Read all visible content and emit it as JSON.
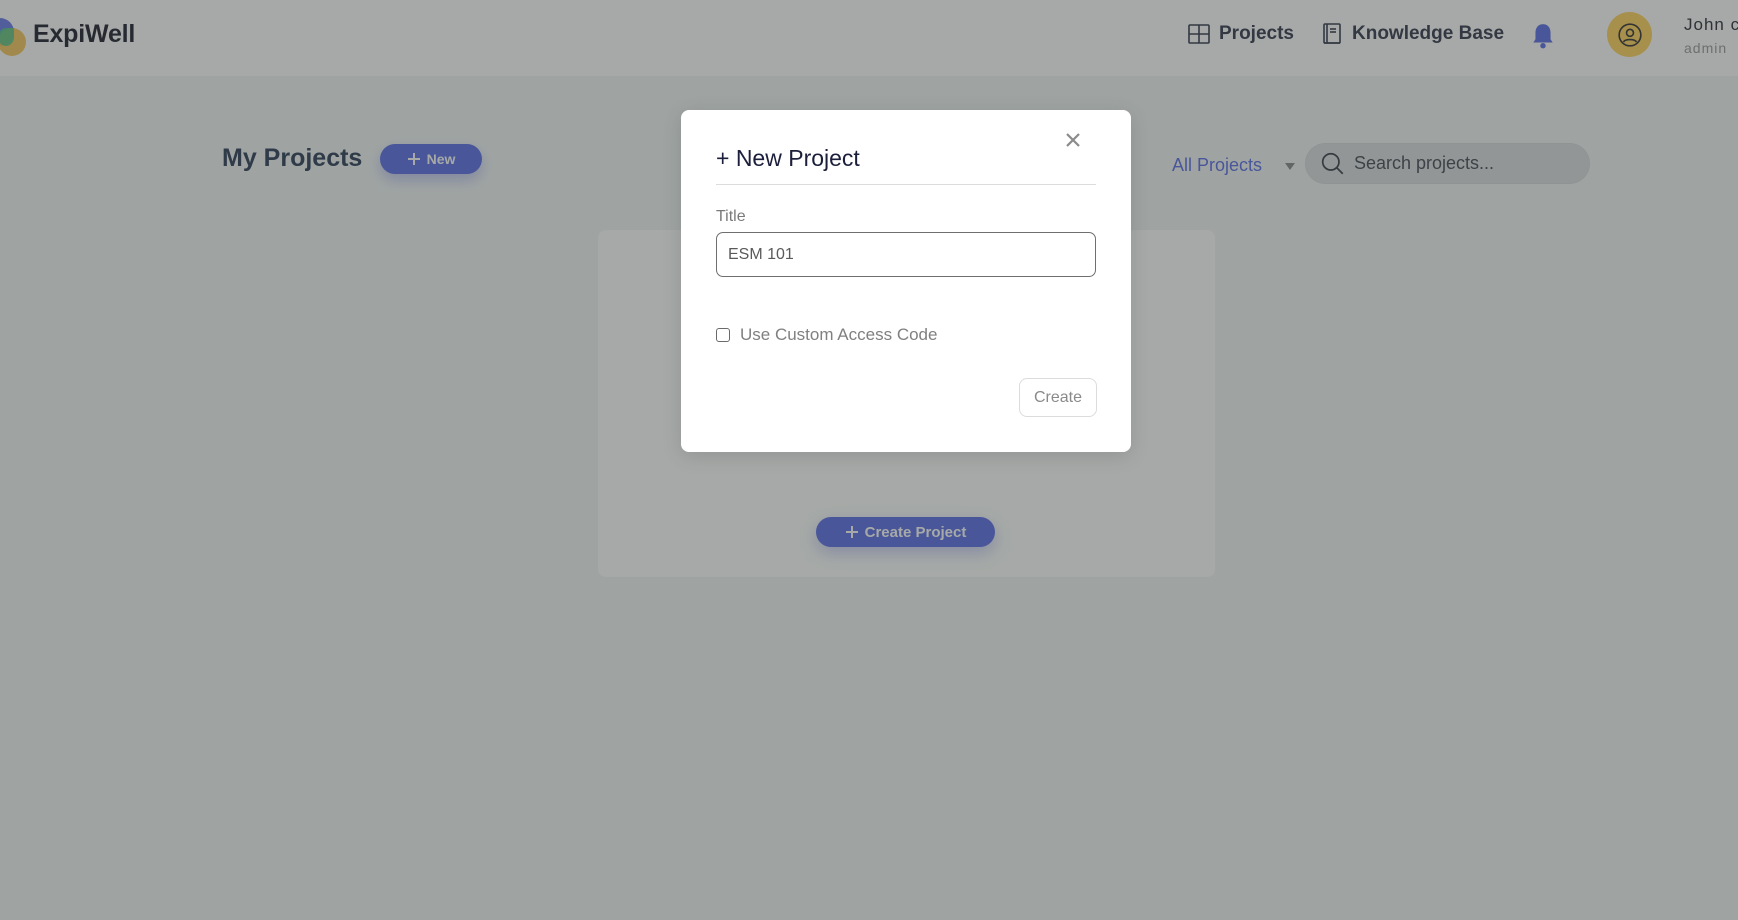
{
  "header": {
    "brand": "ExpiWell",
    "nav": [
      {
        "label": "Projects",
        "icon": "grid-icon"
      },
      {
        "label": "Knowledge Base",
        "icon": "book-icon"
      }
    ],
    "notifications_icon": "bell-icon",
    "user": {
      "name": "John c",
      "role": "admin",
      "avatar_icon": "user-circle-icon"
    }
  },
  "main": {
    "title": "My Projects",
    "new_button": "New",
    "filter": {
      "selected": "All Projects"
    },
    "search": {
      "placeholder": "Search projects...",
      "value": ""
    },
    "empty_state": {
      "create_button": "Create Project"
    }
  },
  "modal": {
    "title": "+ New Project",
    "title_field": {
      "label": "Title",
      "value": "ESM 101"
    },
    "custom_code": {
      "label": "Use Custom Access Code",
      "checked": false
    },
    "create_button": "Create",
    "close_icon": "close-icon"
  },
  "colors": {
    "accent": "#5b6ee8",
    "avatar": "#ffd35c"
  }
}
